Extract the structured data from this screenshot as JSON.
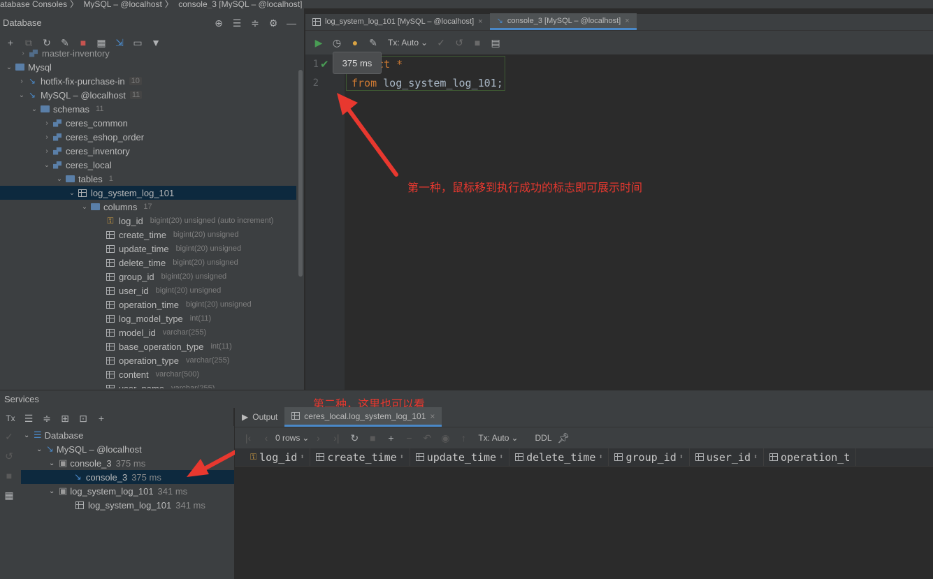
{
  "breadcrumb": [
    "atabase Consoles",
    "MySQL – @localhost",
    "console_3 [MySQL – @localhost]"
  ],
  "db_panel": {
    "title": "Database",
    "tree": [
      {
        "label": "master-inventory",
        "count": "",
        "type": ""
      },
      {
        "label": "Mysql",
        "count": "",
        "type": ""
      },
      {
        "label": "hotfix-fix-purchase-in",
        "count": "10",
        "type": ""
      },
      {
        "label": "MySQL – @localhost",
        "count": "11",
        "type": ""
      },
      {
        "label": "schemas",
        "count": "11",
        "type": ""
      },
      {
        "label": "ceres_common",
        "count": "",
        "type": ""
      },
      {
        "label": "ceres_eshop_order",
        "count": "",
        "type": ""
      },
      {
        "label": "ceres_inventory",
        "count": "",
        "type": ""
      },
      {
        "label": "ceres_local",
        "count": "",
        "type": ""
      },
      {
        "label": "tables",
        "count": "1",
        "type": ""
      },
      {
        "label": "log_system_log_101",
        "count": "",
        "type": ""
      },
      {
        "label": "columns",
        "count": "17",
        "type": ""
      },
      {
        "label": "log_id",
        "count": "",
        "type": "bigint(20) unsigned (auto increment)"
      },
      {
        "label": "create_time",
        "count": "",
        "type": "bigint(20) unsigned"
      },
      {
        "label": "update_time",
        "count": "",
        "type": "bigint(20) unsigned"
      },
      {
        "label": "delete_time",
        "count": "",
        "type": "bigint(20) unsigned"
      },
      {
        "label": "group_id",
        "count": "",
        "type": "bigint(20) unsigned"
      },
      {
        "label": "user_id",
        "count": "",
        "type": "bigint(20) unsigned"
      },
      {
        "label": "operation_time",
        "count": "",
        "type": "bigint(20) unsigned"
      },
      {
        "label": "log_model_type",
        "count": "",
        "type": "int(11)"
      },
      {
        "label": "model_id",
        "count": "",
        "type": "varchar(255)"
      },
      {
        "label": "base_operation_type",
        "count": "",
        "type": "int(11)"
      },
      {
        "label": "operation_type",
        "count": "",
        "type": "varchar(255)"
      },
      {
        "label": "content",
        "count": "",
        "type": "varchar(500)"
      },
      {
        "label": "user_name",
        "count": "",
        "type": "varchar(255)"
      }
    ]
  },
  "editor": {
    "tabs": [
      {
        "label": "log_system_log_101 [MySQL – @localhost]"
      },
      {
        "label": "console_3 [MySQL – @localhost]"
      }
    ],
    "tx_mode": "Tx: Auto",
    "tooltip": "375 ms",
    "line_numbers": [
      "1",
      "2"
    ],
    "line1_tail": "ct *",
    "line2_kw": "from",
    "line2_rest": " log_system_log_101;",
    "annotation": "第一种，鼠标移到执行成功的标志即可展示时间"
  },
  "services": {
    "title": "Services",
    "tx_label": "Tx",
    "annotation": "第二种，这里也可以看",
    "tree": [
      {
        "label": "Database",
        "ms": ""
      },
      {
        "label": "MySQL – @localhost",
        "ms": ""
      },
      {
        "label": "console_3",
        "ms": "375 ms"
      },
      {
        "label": "console_3",
        "ms": "375 ms"
      },
      {
        "label": "log_system_log_101",
        "ms": "341 ms"
      },
      {
        "label": "log_system_log_101",
        "ms": "341 ms"
      }
    ],
    "output_tabs": [
      {
        "label": "Output"
      },
      {
        "label": "ceres_local.log_system_log_101"
      }
    ],
    "rows_label": "0 rows",
    "tx_mode": "Tx: Auto",
    "ddl": "DDL",
    "columns": [
      "log_id",
      "create_time",
      "update_time",
      "delete_time",
      "group_id",
      "user_id",
      "operation_t"
    ]
  },
  "colors": {
    "accent": "#4a88c7",
    "annotation": "#e8382f",
    "run": "#499c54",
    "selection": "#0d293e"
  }
}
